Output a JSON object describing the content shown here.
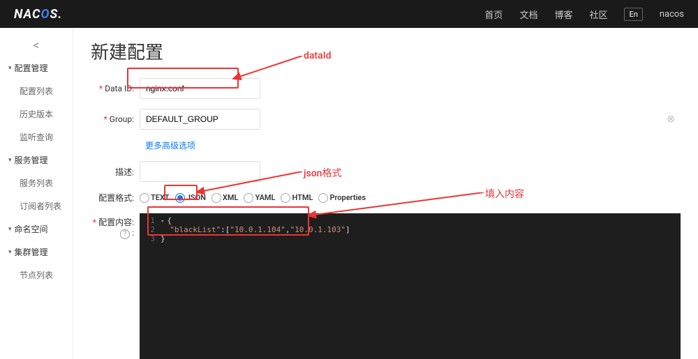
{
  "header": {
    "logo_html": "NACOS.",
    "nav": {
      "home": "首页",
      "docs": "文档",
      "blog": "博客",
      "community": "社区",
      "lang": "En",
      "user": "nacos"
    }
  },
  "sidebar": {
    "groups": [
      {
        "label": "配置管理",
        "items": [
          "配置列表",
          "历史版本",
          "监听查询"
        ]
      },
      {
        "label": "服务管理",
        "items": [
          "服务列表",
          "订阅者列表"
        ]
      },
      {
        "label": "命名空间",
        "items": []
      },
      {
        "label": "集群管理",
        "items": [
          "节点列表"
        ]
      }
    ]
  },
  "page": {
    "title": "新建配置"
  },
  "form": {
    "dataid_label": "Data ID:",
    "dataid_value": "nginx.conf",
    "group_label": "Group:",
    "group_value": "DEFAULT_GROUP",
    "adv_link": "更多高级选项",
    "desc_label": "描述:",
    "desc_value": "",
    "format_label": "配置格式:",
    "formats": [
      "TEXT",
      "JSON",
      "XML",
      "YAML",
      "HTML",
      "Properties"
    ],
    "format_selected": "JSON",
    "content_label": "配置内容:",
    "content_lines": [
      {
        "n": "1",
        "t": "{",
        "fold": true
      },
      {
        "n": "2",
        "t": "  \"blackList\":[\"10.0.1.104\",\"10.0.1.103\"]"
      },
      {
        "n": "3",
        "t": "}"
      }
    ]
  },
  "annotations": {
    "dataid": "dataId",
    "json": "json格式",
    "content": "填入内容"
  }
}
